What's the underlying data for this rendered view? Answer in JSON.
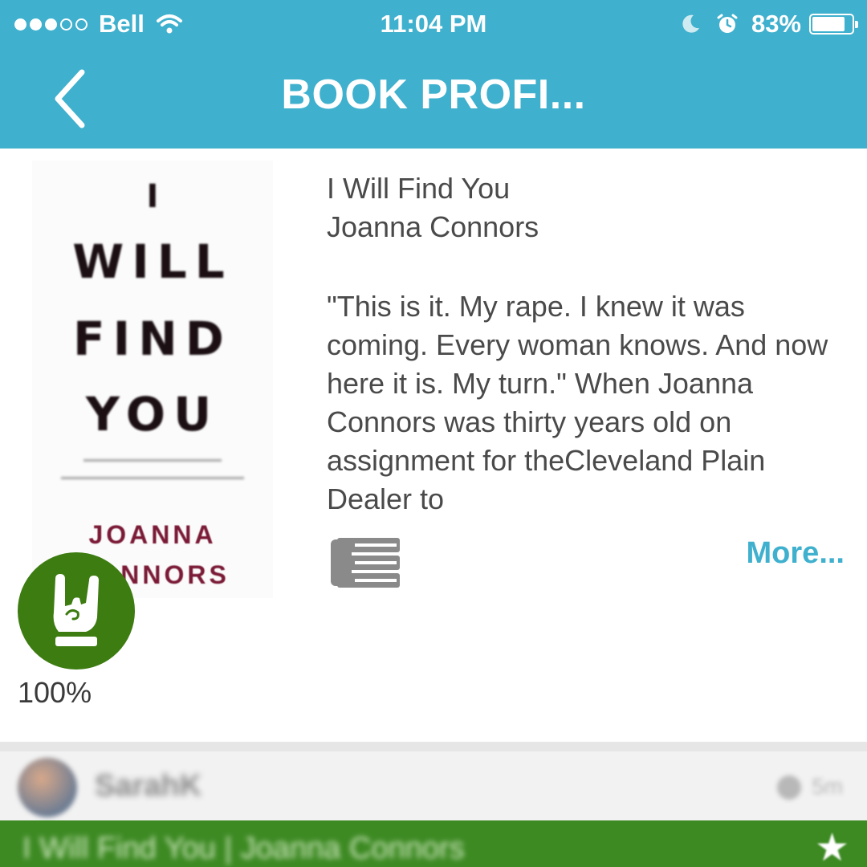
{
  "status_bar": {
    "carrier": "Bell",
    "time": "11:04 PM",
    "battery": "83%",
    "battery_level": 0.83,
    "signal_bars_filled": 3,
    "signal_bars_total": 5
  },
  "nav": {
    "title": "BOOK PROFI..."
  },
  "book": {
    "title": "I Will Find You",
    "author": "Joanna Connors",
    "blurb": "\"This is it. My rape. I knew it was coming. Every woman knows. And now here it is. My turn.\" When Joanna Connors was thirty years old on assignment for theCleveland Plain Dealer to",
    "more_label": "More...",
    "cover": {
      "line1": "I",
      "line2": "WILL",
      "line3": "FIND",
      "line4": "YOU",
      "author_line1": "JOANNA",
      "author_line2": "CONNORS"
    }
  },
  "rating": {
    "percent": "100%",
    "icon": "rock-hand-icon",
    "color": "#3d7c11"
  },
  "review": {
    "reviewer": "SarahK",
    "likes": "5m",
    "bar_text": "I Will Find You | Joanna Connors"
  },
  "colors": {
    "header": "#3fb0cd",
    "accent": "#3fb0cd",
    "review_bar": "#3d8a23"
  }
}
